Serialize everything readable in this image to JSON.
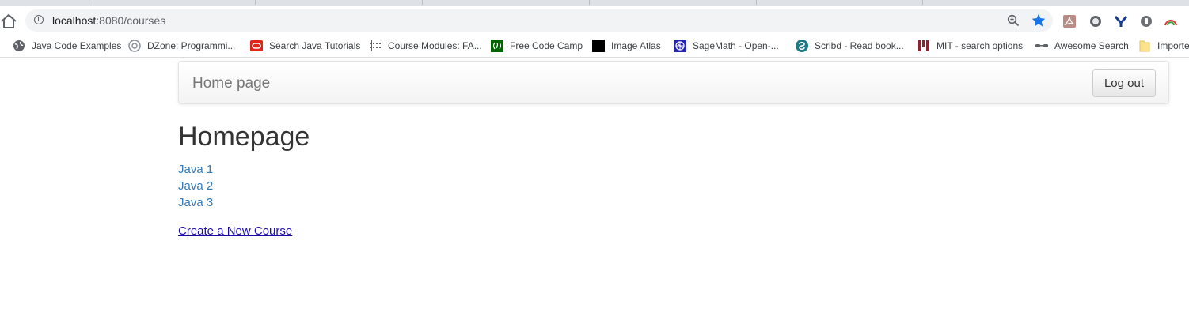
{
  "browser": {
    "url_host": "localhost",
    "url_path": ":8080/courses",
    "bookmarks": [
      {
        "label": "Java Code Examples",
        "icon": "globe-icon"
      },
      {
        "label": "DZone: Programmi...",
        "icon": "dzone-icon"
      },
      {
        "label": "Search Java Tutorials",
        "icon": "oracle-icon"
      },
      {
        "label": "Course Modules: FA...",
        "icon": "modules-icon"
      },
      {
        "label": "Free Code Camp",
        "icon": "freecodecamp-icon"
      },
      {
        "label": "Image Atlas",
        "icon": "image-atlas-icon"
      },
      {
        "label": "SageMath - Open-...",
        "icon": "sagemath-icon"
      },
      {
        "label": "Scribd - Read book...",
        "icon": "scribd-icon"
      },
      {
        "label": "MIT - search options",
        "icon": "mit-icon"
      },
      {
        "label": "Awesome Search",
        "icon": "glasses-icon"
      },
      {
        "label": "Importe",
        "icon": "folder-icon"
      }
    ]
  },
  "navbar": {
    "brand": "Home page",
    "logout_label": "Log out"
  },
  "main": {
    "title": "Homepage",
    "courses": [
      "Java 1",
      "Java 2",
      "Java 3"
    ],
    "create_link": "Create a New Course"
  },
  "colors": {
    "link": "#337ab7",
    "create_link": "#1a0dab",
    "heading": "#333333",
    "brand": "#777777"
  }
}
